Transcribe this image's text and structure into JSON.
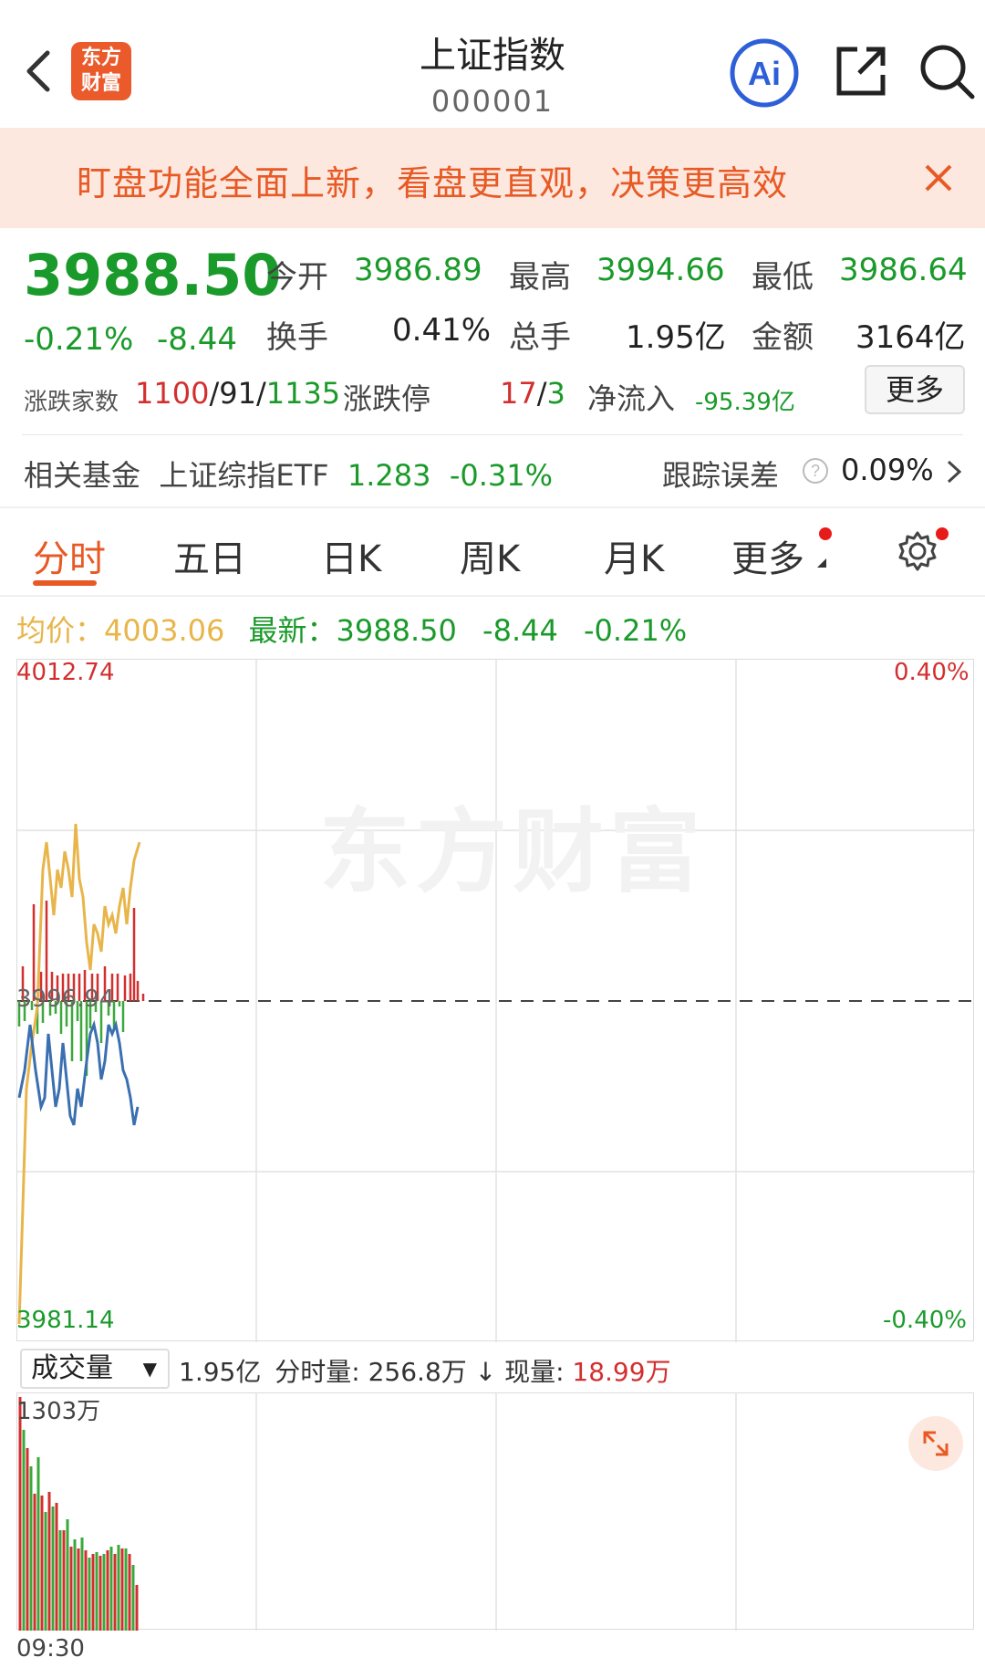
{
  "header": {
    "logo_line1": "东方",
    "logo_line2": "财富",
    "title": "上证指数",
    "code": "000001",
    "ai_label": "Ai"
  },
  "banner": {
    "text": "盯盘功能全面上新，看盘更直观，决策更高效"
  },
  "quote": {
    "price": "3988.50",
    "change_pct": "-0.21%",
    "change_abs": "-8.44",
    "open_label": "今开",
    "open_value": "3986.89",
    "high_label": "最高",
    "high_value": "3994.66",
    "low_label": "最低",
    "low_value": "3986.64",
    "turnover_label": "换手",
    "turnover_value": "0.41%",
    "volume_label": "总手",
    "volume_value": "1.95亿",
    "amount_label": "金额",
    "amount_value": "3164亿",
    "breadth_label": "涨跌家数",
    "breadth_up": "1100",
    "breadth_sep1": "/",
    "breadth_flat": "91",
    "breadth_sep2": "/",
    "breadth_down": "1135",
    "limit_label": "涨跌停",
    "limit_up": "17",
    "limit_sep": "/",
    "limit_down": "3",
    "netflow_label": "净流入",
    "netflow_value": "-95.39亿",
    "more_label": "更多"
  },
  "fund": {
    "label": "相关基金",
    "name": "上证综指ETF",
    "price": "1.283",
    "change": "-0.31%",
    "tracking_label": "跟踪误差",
    "tracking_value": "0.09%"
  },
  "tabs": [
    "分时",
    "五日",
    "日K",
    "周K",
    "月K",
    "更多"
  ],
  "chart_header": {
    "avg_label": "均价：",
    "avg_value": "4003.06",
    "latest_label": "最新：",
    "latest_value": "3988.50",
    "latest_change": "-8.44",
    "latest_pct": "-0.21%"
  },
  "chart_axis": {
    "top_price": "4012.74",
    "mid_price": "3996.94",
    "bottom_price": "3981.14",
    "top_pct": "0.40%",
    "bottom_pct": "-0.40%"
  },
  "watermark": "东方财富",
  "volume": {
    "select_label": "成交量",
    "total": "1.95亿",
    "minute_label": "分时量:",
    "minute_value": "256.8万",
    "now_label": "现量:",
    "now_value": "18.99万",
    "max_label": "1303万",
    "time_start": "09:30"
  },
  "colors": {
    "up": "#d32f2f",
    "down": "#1a9a2a",
    "accent": "#e85a25",
    "avg_line": "#e8b54a",
    "ratio_line": "#3a6fb0"
  }
}
